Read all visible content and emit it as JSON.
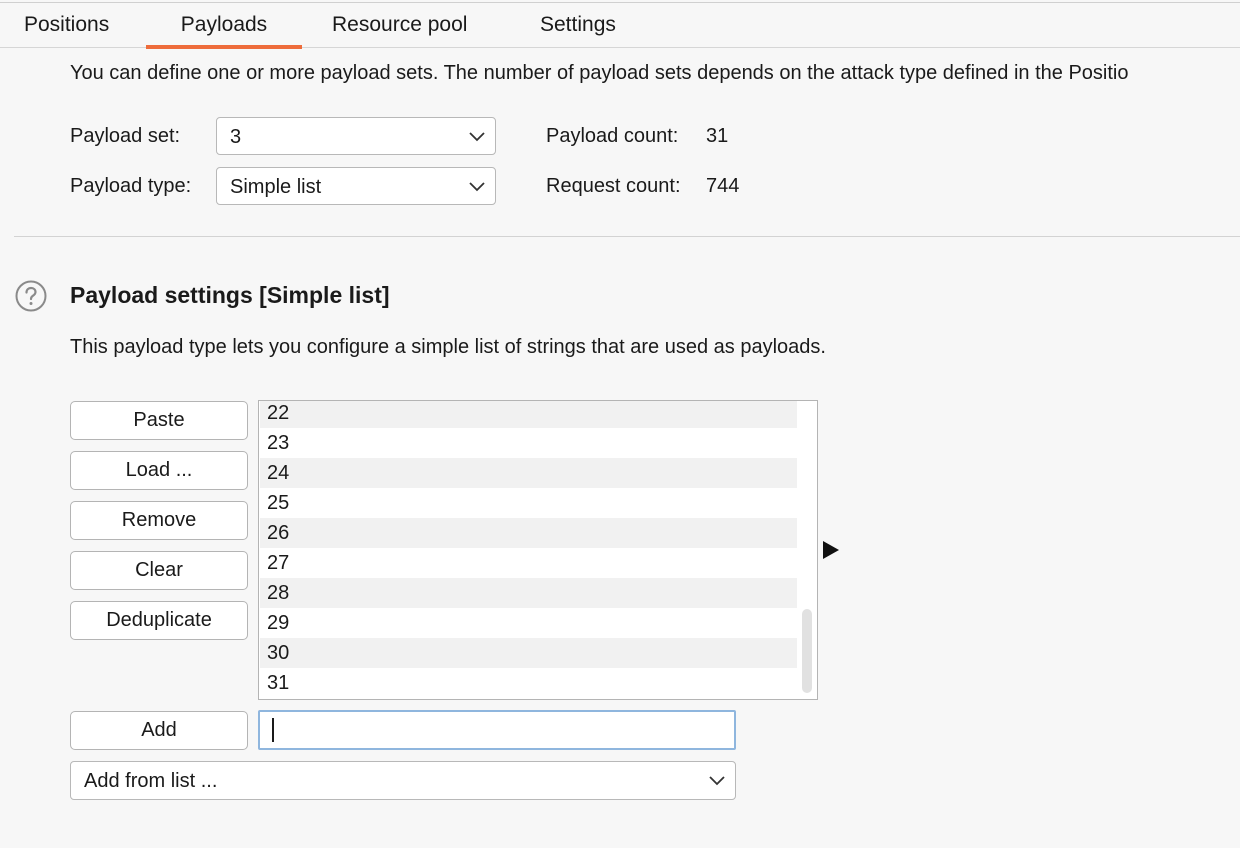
{
  "tabs": [
    {
      "label": "Positions"
    },
    {
      "label": "Payloads",
      "selected": true
    },
    {
      "label": "Resource pool"
    },
    {
      "label": "Settings"
    }
  ],
  "intro_text": "You can define one or more payload sets. The number of payload sets depends on the attack type defined in the Positio",
  "payload_set": {
    "label": "Payload set:",
    "value": "3"
  },
  "payload_type": {
    "label": "Payload type:",
    "value": "Simple list"
  },
  "payload_count": {
    "label": "Payload count:",
    "value": "31"
  },
  "request_count": {
    "label": "Request count:",
    "value": "744"
  },
  "section": {
    "title": "Payload settings [Simple list]",
    "description": "This payload type lets you configure a simple list of strings that are used as payloads."
  },
  "buttons": {
    "paste": "Paste",
    "load": "Load ...",
    "remove": "Remove",
    "clear": "Clear",
    "deduplicate": "Deduplicate",
    "add": "Add"
  },
  "list_items": [
    "22",
    "23",
    "24",
    "25",
    "26",
    "27",
    "28",
    "29",
    "30",
    "31"
  ],
  "add_input": {
    "value": ""
  },
  "add_from_list": {
    "value": "Add from list ..."
  },
  "colors": {
    "accent": "#ee6c3b",
    "focus_border": "#8fb6de",
    "background": "#f7f7f7",
    "row_alt": "#f1f1f1"
  },
  "icons": [
    "help-icon",
    "chevron-down-icon",
    "play-arrow-icon"
  ]
}
